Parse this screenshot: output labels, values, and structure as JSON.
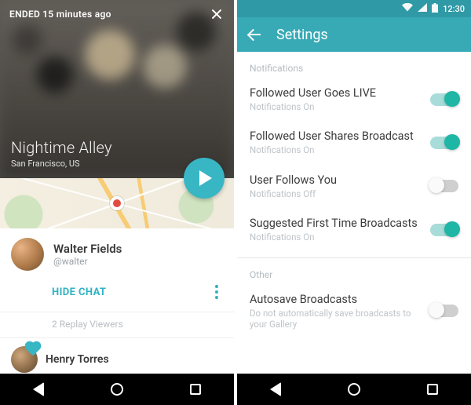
{
  "left": {
    "status": {
      "ended_label": "ENDED",
      "ago": "15 minutes ago"
    },
    "title": "Nightime Alley",
    "location": "San Francisco, US",
    "user": {
      "name": "Walter Fields",
      "handle": "@walter"
    },
    "hide_chat": "HIDE CHAT",
    "replay_viewers": "2 Replay Viewers",
    "viewer": {
      "name": "Henry Torres"
    }
  },
  "right": {
    "clock": "12:30",
    "appbar_title": "Settings",
    "group_notifications": "Notifications",
    "group_other": "Other",
    "settings": [
      {
        "title": "Followed User Goes LIVE",
        "sub": "Notifications On",
        "on": true
      },
      {
        "title": "Followed User Shares Broadcast",
        "sub": "Notifications On",
        "on": true
      },
      {
        "title": "User Follows You",
        "sub": "Notifications Off",
        "on": false
      },
      {
        "title": "Suggested First Time Broadcasts",
        "sub": "Notifications On",
        "on": true
      }
    ],
    "autosave": {
      "title": "Autosave Broadcasts",
      "sub": "Do not automatically save broadcasts to your Gallery",
      "on": false
    }
  },
  "colors": {
    "accent": "#38b6c4",
    "toggle_on": "#1fb6a5"
  }
}
